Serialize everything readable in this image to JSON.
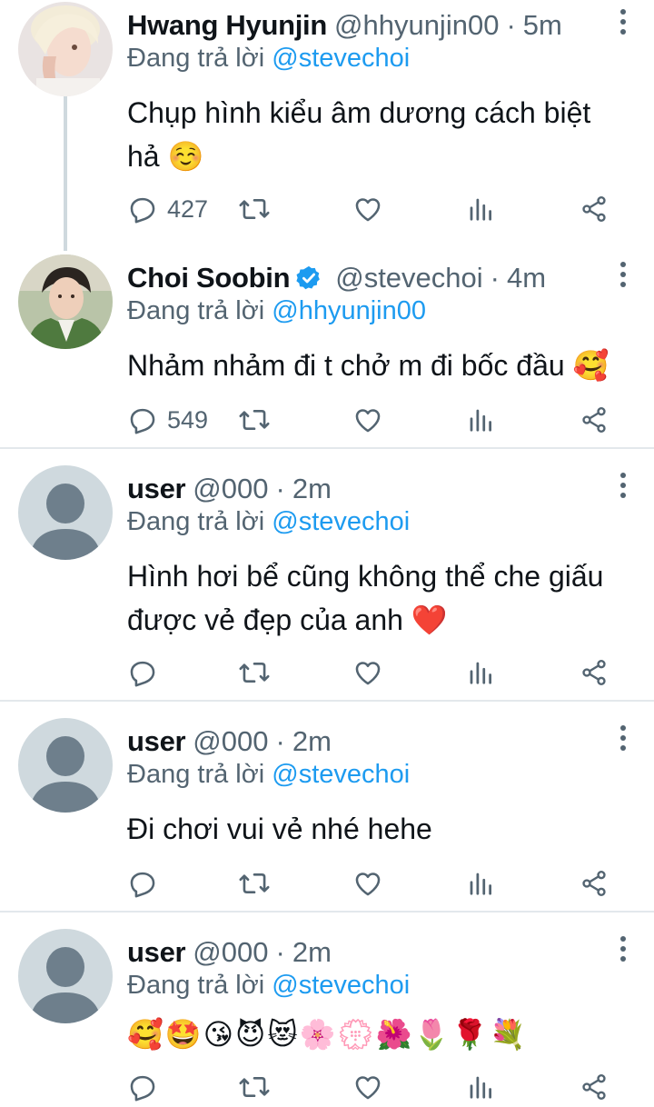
{
  "reply_prefix": "Đang trả lời",
  "tweets": [
    {
      "name": "Hwang Hyunjin",
      "handle": "@hhyunjin00",
      "time": "5m",
      "replying_to": "@stevechoi",
      "text_lines": [
        "Chụp hình kiểu âm dương cách biệt",
        "hả ☺️"
      ],
      "reply_count": "427",
      "verified": false,
      "avatar": "photo-blonde-person"
    },
    {
      "name": "Choi Soobin",
      "handle": "@stevechoi",
      "time": "4m",
      "replying_to": "@hhyunjin00",
      "text_lines": [
        "Nhảm nhảm đi t chở m đi bốc đầu 🥰"
      ],
      "reply_count": "549",
      "verified": true,
      "avatar": "photo-person-green-jacket"
    },
    {
      "name": "user",
      "handle": "@000",
      "time": "2m",
      "replying_to": "@stevechoi",
      "text_lines": [
        "Hình hơi bể cũng không thể che giấu",
        "được vẻ đẹp của anh ❤️"
      ],
      "reply_count": "",
      "verified": false,
      "avatar": "default-profile"
    },
    {
      "name": "user",
      "handle": "@000",
      "time": "2m",
      "replying_to": "@stevechoi",
      "text_lines": [
        "Đi chơi vui vẻ nhé hehe"
      ],
      "reply_count": "",
      "verified": false,
      "avatar": "default-profile"
    },
    {
      "name": "user",
      "handle": "@000",
      "time": "2m",
      "replying_to": "@stevechoi",
      "text_lines": [
        "🥰🤩😘😈😻🌸💮🌺🌷🌹💐"
      ],
      "reply_count": "",
      "verified": false,
      "avatar": "default-profile"
    }
  ],
  "icons": {
    "reply": "reply-icon",
    "retweet": "retweet-icon",
    "like": "like-icon",
    "views": "views-icon",
    "share": "share-icon",
    "more": "more-icon",
    "verified": "verified-icon"
  },
  "colors": {
    "accent": "#1d9bf0",
    "secondary_text": "#536471",
    "divider": "#e3e8ec",
    "thread_line": "#cfd9de"
  }
}
